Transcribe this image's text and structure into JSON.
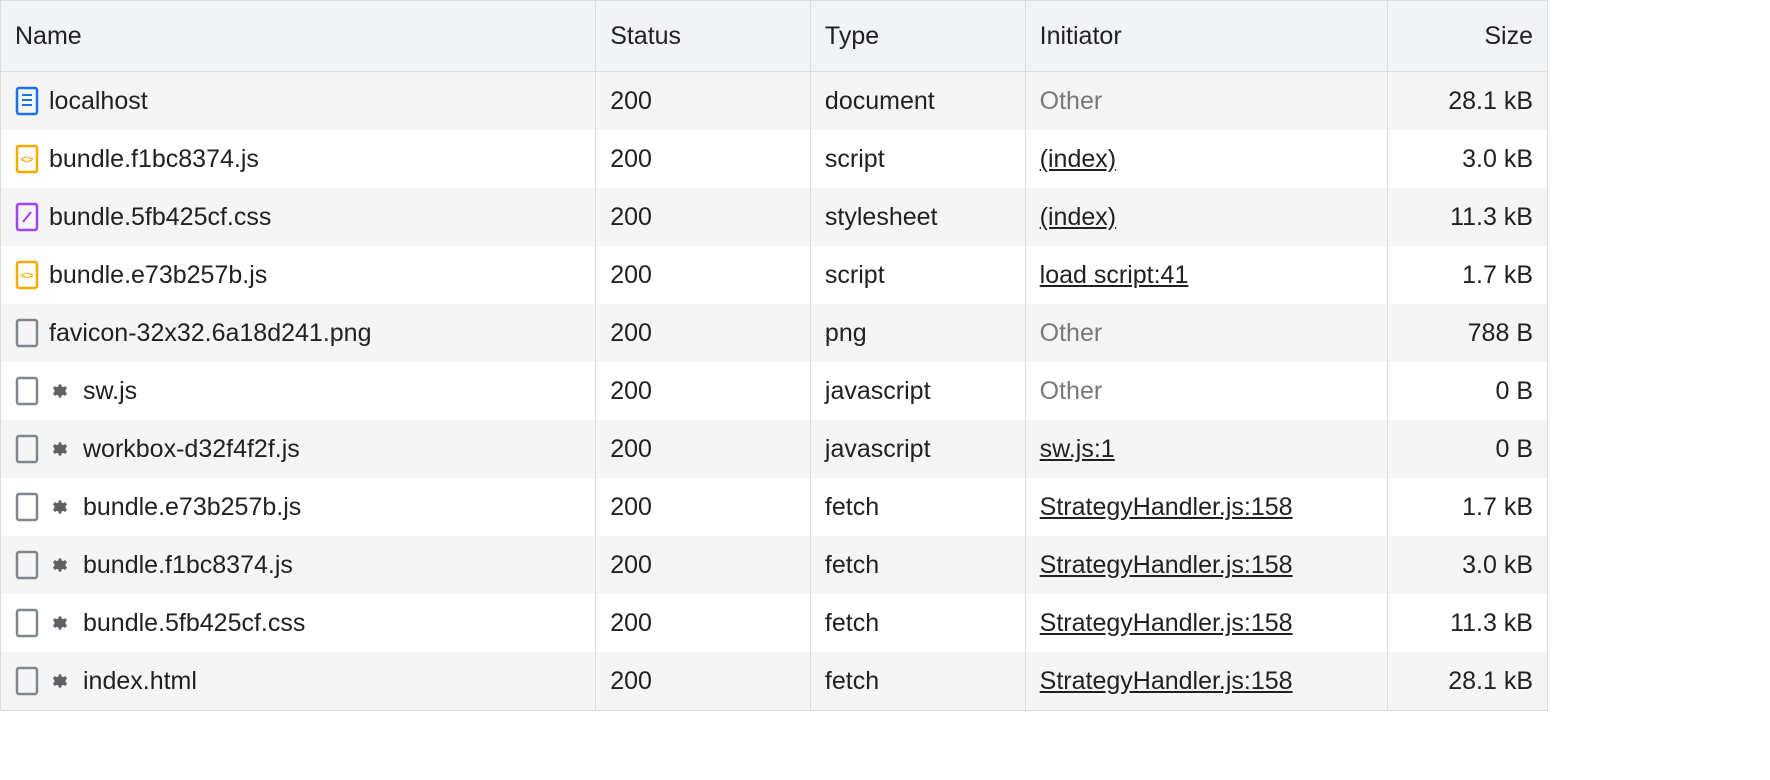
{
  "columns": {
    "name": "Name",
    "status": "Status",
    "type": "Type",
    "initiator": "Initiator",
    "size": "Size"
  },
  "rows": [
    {
      "icon": "document",
      "gear": false,
      "name": "localhost",
      "status": "200",
      "type": "document",
      "initiator": "Other",
      "initiatorLink": false,
      "size": "28.1 kB"
    },
    {
      "icon": "script",
      "gear": false,
      "name": "bundle.f1bc8374.js",
      "status": "200",
      "type": "script",
      "initiator": "(index)",
      "initiatorLink": true,
      "size": "3.0 kB"
    },
    {
      "icon": "stylesheet",
      "gear": false,
      "name": "bundle.5fb425cf.css",
      "status": "200",
      "type": "stylesheet",
      "initiator": "(index)",
      "initiatorLink": true,
      "size": "11.3 kB"
    },
    {
      "icon": "script",
      "gear": false,
      "name": "bundle.e73b257b.js",
      "status": "200",
      "type": "script",
      "initiator": "load script:41",
      "initiatorLink": true,
      "size": "1.7 kB"
    },
    {
      "icon": "generic",
      "gear": false,
      "name": "favicon-32x32.6a18d241.png",
      "status": "200",
      "type": "png",
      "initiator": "Other",
      "initiatorLink": false,
      "size": "788 B"
    },
    {
      "icon": "generic",
      "gear": true,
      "name": "sw.js",
      "status": "200",
      "type": "javascript",
      "initiator": "Other",
      "initiatorLink": false,
      "size": "0 B"
    },
    {
      "icon": "generic",
      "gear": true,
      "name": "workbox-d32f4f2f.js",
      "status": "200",
      "type": "javascript",
      "initiator": "sw.js:1",
      "initiatorLink": true,
      "size": "0 B"
    },
    {
      "icon": "generic",
      "gear": true,
      "name": "bundle.e73b257b.js",
      "status": "200",
      "type": "fetch",
      "initiator": "StrategyHandler.js:158",
      "initiatorLink": true,
      "size": "1.7 kB"
    },
    {
      "icon": "generic",
      "gear": true,
      "name": "bundle.f1bc8374.js",
      "status": "200",
      "type": "fetch",
      "initiator": "StrategyHandler.js:158",
      "initiatorLink": true,
      "size": "3.0 kB"
    },
    {
      "icon": "generic",
      "gear": true,
      "name": "bundle.5fb425cf.css",
      "status": "200",
      "type": "fetch",
      "initiator": "StrategyHandler.js:158",
      "initiatorLink": true,
      "size": "11.3 kB"
    },
    {
      "icon": "generic",
      "gear": true,
      "name": "index.html",
      "status": "200",
      "type": "fetch",
      "initiator": "StrategyHandler.js:158",
      "initiatorLink": true,
      "size": "28.1 kB"
    }
  ]
}
